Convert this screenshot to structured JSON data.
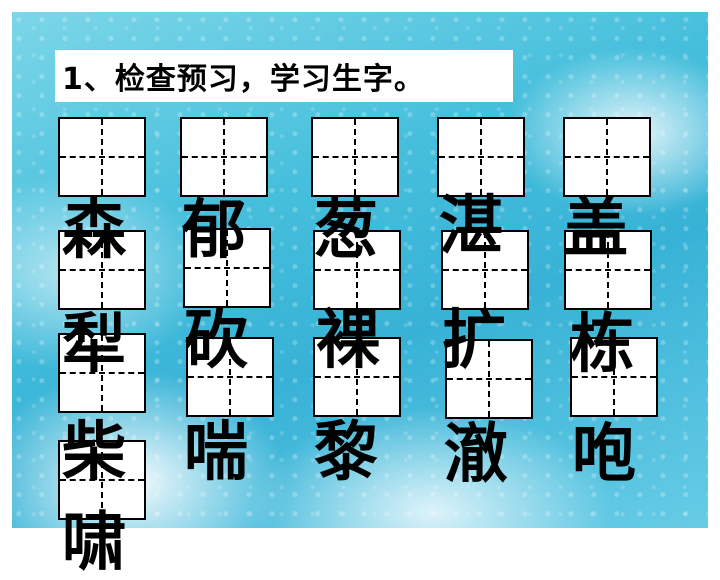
{
  "slide": {
    "title": "1、检查预习，学习生字。"
  },
  "characters": [
    "森",
    "郁",
    "葱",
    "湛",
    "盖",
    "犁",
    "砍",
    "裸",
    "扩",
    "栋",
    "柴",
    "喘",
    "黎",
    "澈",
    "咆",
    "啸"
  ]
}
